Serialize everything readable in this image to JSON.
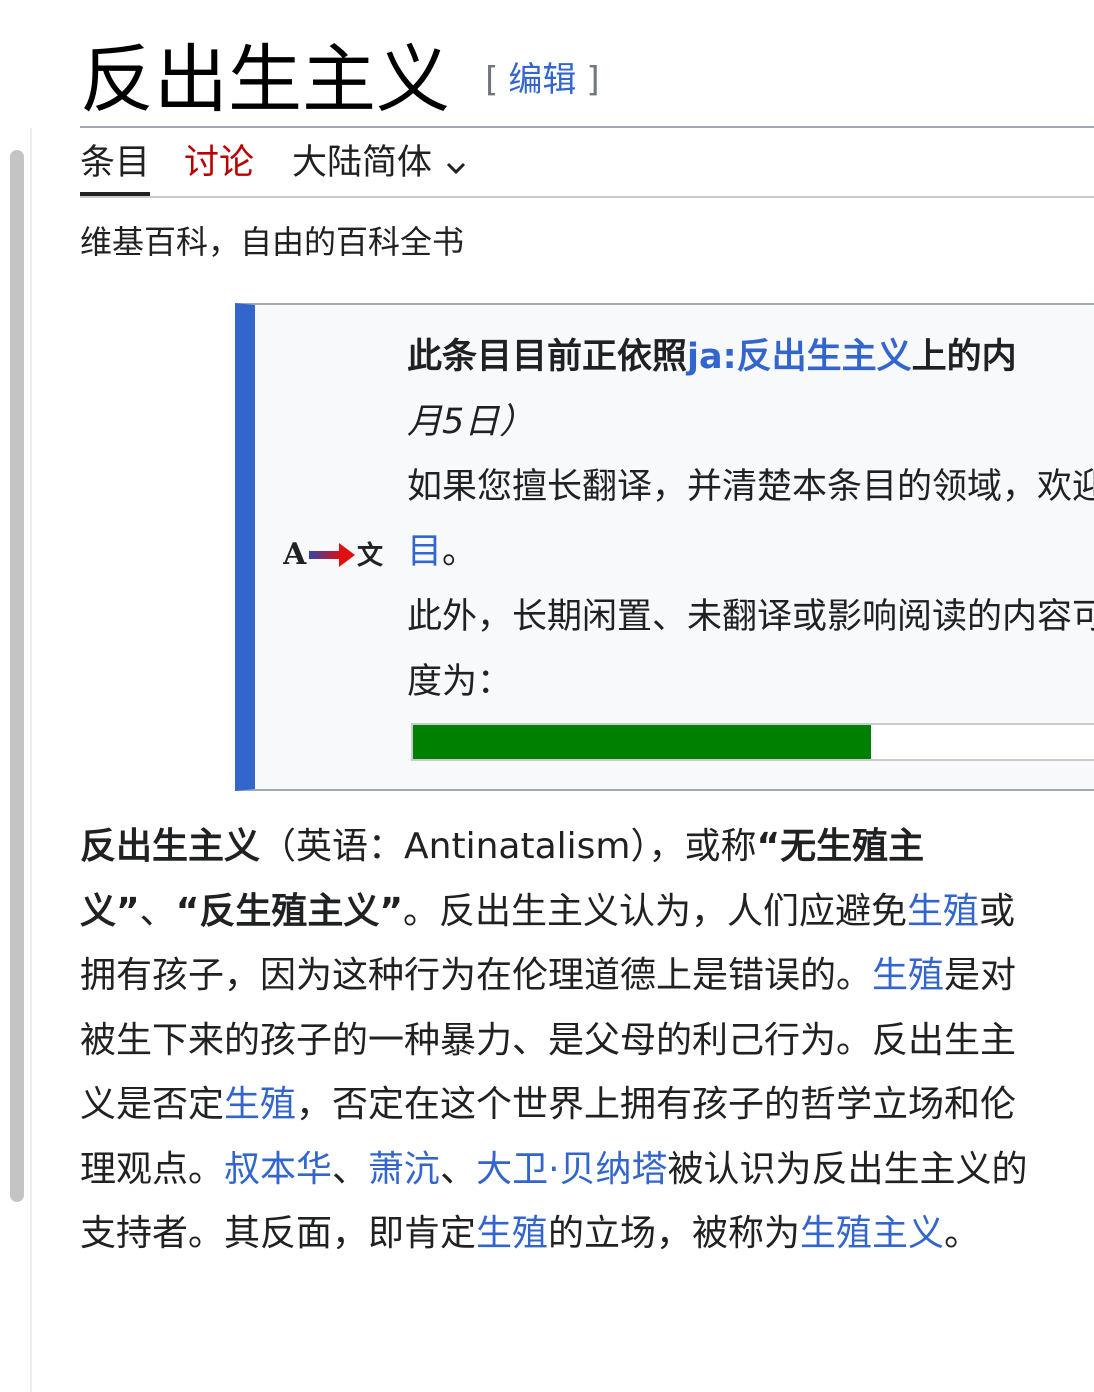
{
  "header": {
    "title": "反出生主义",
    "edit_open": "[",
    "edit_label": "编辑",
    "edit_close": "]"
  },
  "tabs": {
    "article": "条目",
    "talk": "讨论",
    "variant": "大陆简体"
  },
  "site_subtitle": "维基百科，自由的百科全书",
  "notice": {
    "icon": "translate-icon",
    "icon_letter_a": "A",
    "icon_letter_wen": "文",
    "line1_prefix": "此条目目前正依照",
    "line1_link": "ja:反出生主义",
    "line1_suffix": "上的内",
    "line2": "月5日）",
    "line3": "如果您擅长翻译，并清楚本条目的领域，欢迎",
    "line4_link": "目",
    "line4_suffix": "。",
    "line5": "此外，长期闲置、未翻译或影响阅读的内容可",
    "line6": "度为：",
    "progress_fraction": 0.64,
    "progress_color": "#008000",
    "border_color": "#3366cc"
  },
  "article": {
    "p1_bold": "反出生主义",
    "p1_a": "（英语：Antinatalism），或称",
    "p1_bold2": "“无生殖主义”",
    "p1_b": "、",
    "p1_bold3": "“反生殖主义”",
    "p1_c": "。反出生主义认为，人们应避免",
    "link_shengzhi_1": "生殖",
    "p1_d": "或拥有孩子，因为这种行为在伦理道德上是错误的。",
    "link_shengzhi_2": "生殖",
    "p1_e": "是对被生下来的孩子的一种暴力、是父母的利己行为。反出生主义是否定",
    "link_shengzhi_3": "生殖",
    "p1_f": "，否定在这个世界上拥有孩子的哲学立场和伦理观点。",
    "link_schopenhauer": "叔本华",
    "sep1": "、",
    "link_xiaoyuan": "萧沆",
    "sep2": "、",
    "link_benatar": "大卫·贝纳塔",
    "p1_g": "被认识为反出生主义的支持者。其反面，即肯定",
    "link_shengzhi_4": "生殖",
    "p1_h": "的立场，被称为",
    "link_pronatalism": "生殖主义",
    "p1_end": "。"
  }
}
